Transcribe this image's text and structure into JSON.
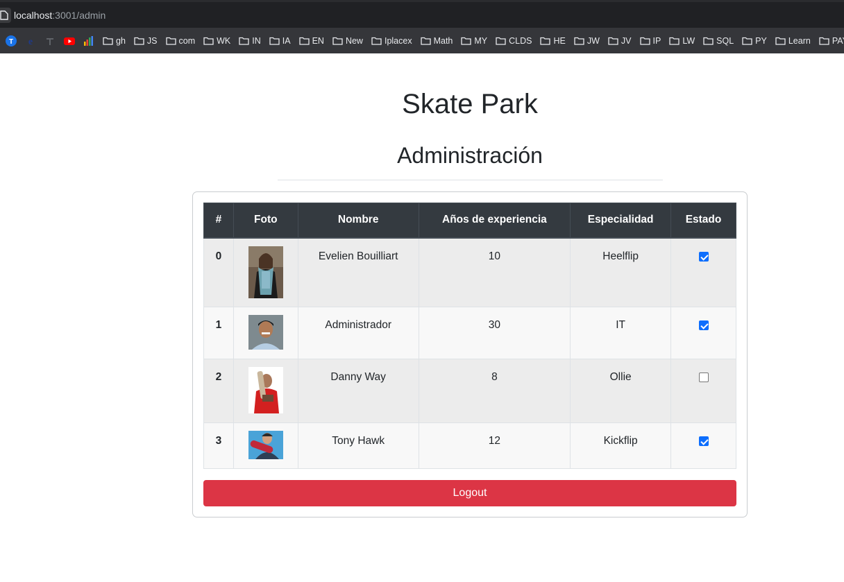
{
  "browser": {
    "url_host": "localhost",
    "url_rest": ":3001/admin",
    "bookmark_folders": [
      "gh",
      "JS",
      "com",
      "WK",
      "IN",
      "IA",
      "EN",
      "New",
      "Iplacex",
      "Math",
      "MY",
      "CLDS",
      "HE",
      "JW",
      "JV",
      "IP",
      "LW",
      "SQL",
      "PY",
      "Learn",
      "PAY"
    ]
  },
  "page": {
    "title": "Skate Park",
    "subtitle": "Administración"
  },
  "table": {
    "headers": [
      "#",
      "Foto",
      "Nombre",
      "Años de experiencia",
      "Especialidad",
      "Estado"
    ],
    "rows": [
      {
        "index": "0",
        "name": "Evelien Bouilliart",
        "years": "10",
        "specialty": "Heelflip",
        "status": true
      },
      {
        "index": "1",
        "name": "Administrador",
        "years": "30",
        "specialty": "IT",
        "status": true
      },
      {
        "index": "2",
        "name": "Danny Way",
        "years": "8",
        "specialty": "Ollie",
        "status": false
      },
      {
        "index": "3",
        "name": "Tony Hawk",
        "years": "12",
        "specialty": "Kickflip",
        "status": true
      }
    ]
  },
  "actions": {
    "logout_label": "Logout"
  },
  "colors": {
    "header_bg": "#343a40",
    "logout_bg": "#dc3545",
    "checkbox_on": "#0d6efd"
  }
}
